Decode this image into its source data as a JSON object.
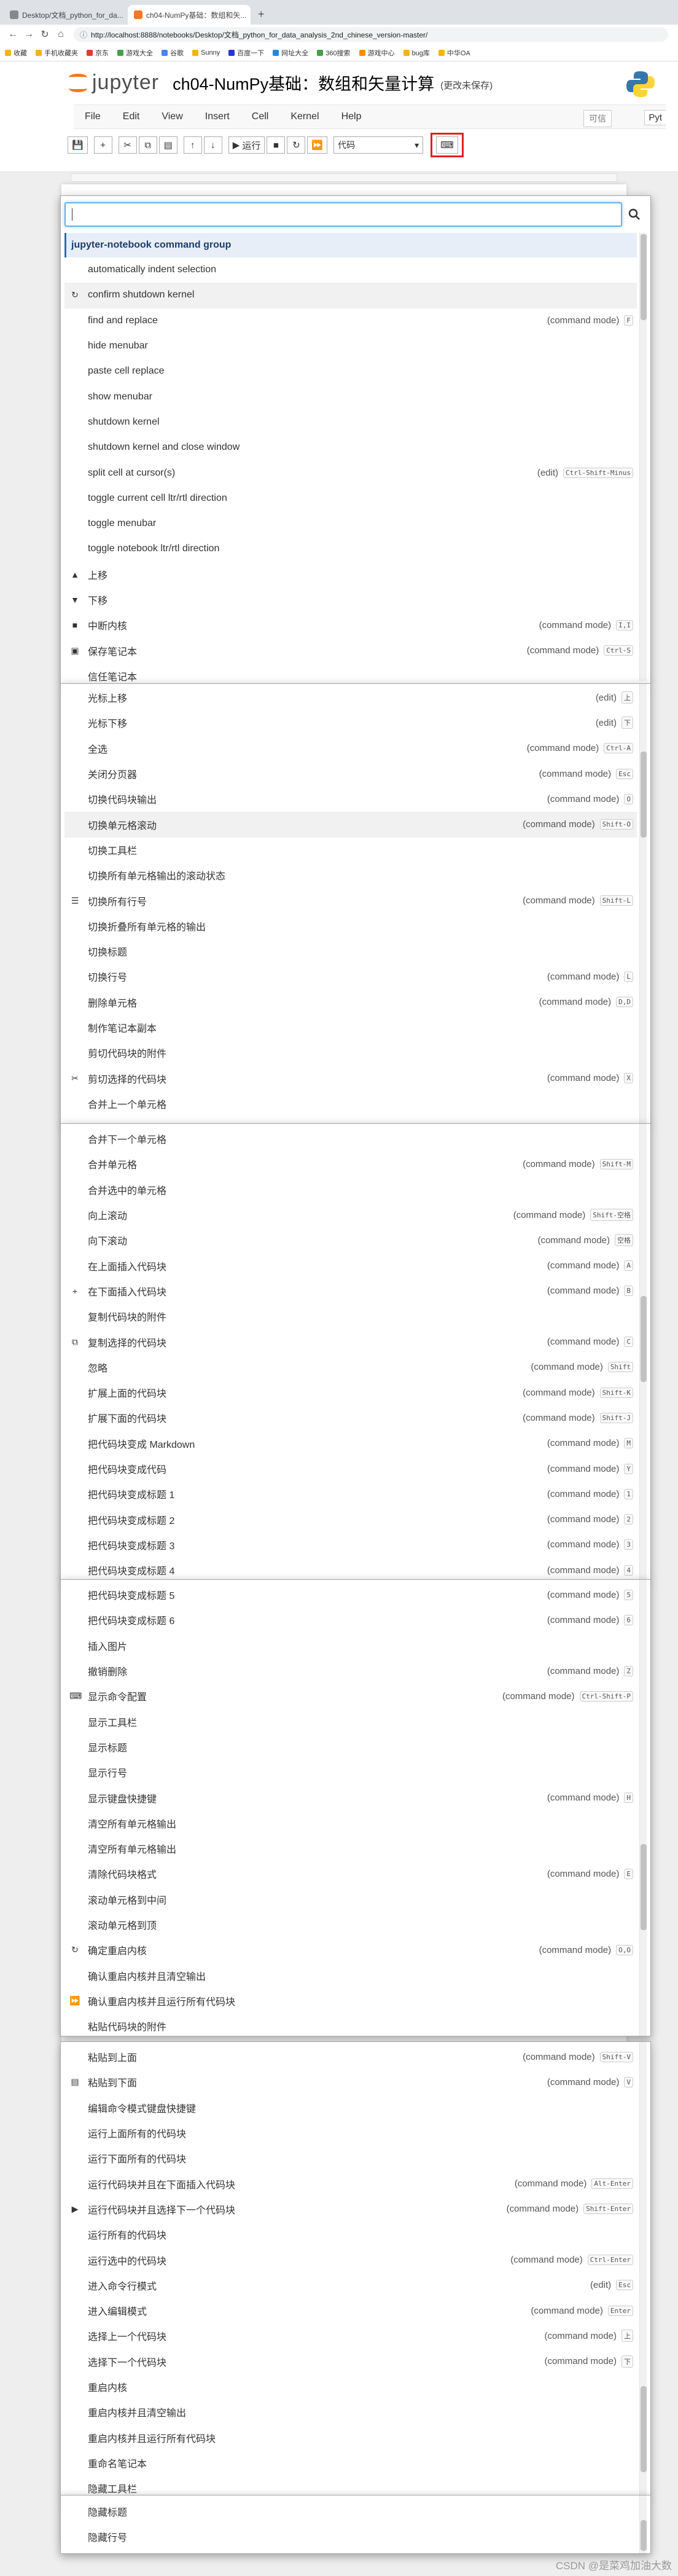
{
  "browser": {
    "tabs": [
      {
        "label": "Desktop/文档_python_for_da..."
      },
      {
        "label": "ch04-NumPy基础：数组和矢..."
      }
    ],
    "url": "http://localhost:8888/notebooks/Desktop/文档_python_for_data_analysis_2nd_chinese_version-master/",
    "bookmarks": [
      "收藏",
      "手机收藏夹",
      "京东",
      "游戏大全",
      "谷歌",
      "Sunny",
      "百度一下",
      "网址大全",
      "360搜索",
      "游戏中心",
      "bug库",
      "中华OA"
    ]
  },
  "jupyter": {
    "wordmark": "jupyter",
    "notebook_title": "ch04-NumPy基础：数组和矢量计算",
    "save_status": "(更改未保存)",
    "trusted": "可信",
    "kernel": "Pyt",
    "menus": [
      "File",
      "Edit",
      "View",
      "Insert",
      "Cell",
      "Kernel",
      "Help"
    ],
    "run_label": "运行",
    "cell_type": "代码"
  },
  "palette": {
    "group_header": "jupyter-notebook command group",
    "panel1": [
      {
        "label": "automatically indent selection",
        "icon": "",
        "mode": "",
        "key": ""
      },
      {
        "label": "confirm shutdown kernel",
        "icon": "↻",
        "mode": "",
        "key": "",
        "hl": true
      },
      {
        "label": "find and replace",
        "icon": "",
        "mode": "(command mode)",
        "key": "F"
      },
      {
        "label": "hide menubar",
        "icon": "",
        "mode": "",
        "key": ""
      },
      {
        "label": "paste cell replace",
        "icon": "",
        "mode": "",
        "key": ""
      },
      {
        "label": "show menubar",
        "icon": "",
        "mode": "",
        "key": ""
      },
      {
        "label": "shutdown kernel",
        "icon": "",
        "mode": "",
        "key": ""
      },
      {
        "label": "shutdown kernel and close window",
        "icon": "",
        "mode": "",
        "key": ""
      },
      {
        "label": "split cell at cursor(s)",
        "icon": "",
        "mode": "(edit)",
        "key": "Ctrl-Shift-Minus"
      },
      {
        "label": "toggle current cell ltr/rtl direction",
        "icon": "",
        "mode": "",
        "key": ""
      },
      {
        "label": "toggle menubar",
        "icon": "",
        "mode": "",
        "key": ""
      },
      {
        "label": "toggle notebook ltr/rtl direction",
        "icon": "",
        "mode": "",
        "key": ""
      },
      {
        "label": "上移",
        "icon": "▲",
        "mode": "",
        "key": ""
      },
      {
        "label": "下移",
        "icon": "▼",
        "mode": "",
        "key": ""
      },
      {
        "label": "中断内核",
        "icon": "■",
        "mode": "(command mode)",
        "key": "I,I"
      },
      {
        "label": "保存笔记本",
        "icon": "▣",
        "mode": "(command mode)",
        "key": "Ctrl-S"
      },
      {
        "label": "信任笔记本",
        "icon": "",
        "mode": "",
        "key": ""
      }
    ],
    "panel2": [
      {
        "label": "光标上移",
        "icon": "",
        "mode": "(edit)",
        "key": "上"
      },
      {
        "label": "光标下移",
        "icon": "",
        "mode": "(edit)",
        "key": "下"
      },
      {
        "label": "全选",
        "icon": "",
        "mode": "(command mode)",
        "key": "Ctrl-A"
      },
      {
        "label": "关闭分页器",
        "icon": "",
        "mode": "(command mode)",
        "key": "Esc"
      },
      {
        "label": "切换代码块输出",
        "icon": "",
        "mode": "(command mode)",
        "key": "O"
      },
      {
        "label": "切换单元格滚动",
        "icon": "",
        "mode": "(command mode)",
        "key": "Shift-O",
        "hl": true
      },
      {
        "label": "切换工具栏",
        "icon": "",
        "mode": "",
        "key": ""
      },
      {
        "label": "切换所有单元格输出的滚动状态",
        "icon": "",
        "mode": "",
        "key": ""
      },
      {
        "label": "切换所有行号",
        "icon": "☰",
        "mode": "(command mode)",
        "key": "Shift-L"
      },
      {
        "label": "切换折叠所有单元格的输出",
        "icon": "",
        "mode": "",
        "key": ""
      },
      {
        "label": "切换标题",
        "icon": "",
        "mode": "",
        "key": ""
      },
      {
        "label": "切换行号",
        "icon": "",
        "mode": "(command mode)",
        "key": "L"
      },
      {
        "label": "删除单元格",
        "icon": "",
        "mode": "(command mode)",
        "key": "D,D"
      },
      {
        "label": "制作笔记本副本",
        "icon": "",
        "mode": "",
        "key": ""
      },
      {
        "label": "剪切代码块的附件",
        "icon": "",
        "mode": "",
        "key": ""
      },
      {
        "label": "剪切选择的代码块",
        "icon": "✂",
        "mode": "(command mode)",
        "key": "X"
      },
      {
        "label": "合并上一个单元格",
        "icon": "",
        "mode": "",
        "key": ""
      }
    ],
    "panel3": [
      {
        "label": "合并下一个单元格",
        "icon": "",
        "mode": "",
        "key": ""
      },
      {
        "label": "合并单元格",
        "icon": "",
        "mode": "(command mode)",
        "key": "Shift-M"
      },
      {
        "label": "合并选中的单元格",
        "icon": "",
        "mode": "",
        "key": ""
      },
      {
        "label": "向上滚动",
        "icon": "",
        "mode": "(command mode)",
        "key": "Shift-空格"
      },
      {
        "label": "向下滚动",
        "icon": "",
        "mode": "(command mode)",
        "key": "空格"
      },
      {
        "label": "在上面插入代码块",
        "icon": "",
        "mode": "(command mode)",
        "key": "A"
      },
      {
        "label": "在下面插入代码块",
        "icon": "+",
        "mode": "(command mode)",
        "key": "B"
      },
      {
        "label": "复制代码块的附件",
        "icon": "",
        "mode": "",
        "key": ""
      },
      {
        "label": "复制选择的代码块",
        "icon": "⧉",
        "mode": "(command mode)",
        "key": "C"
      },
      {
        "label": "忽略",
        "icon": "",
        "mode": "(command mode)",
        "key": "Shift"
      },
      {
        "label": "扩展上面的代码块",
        "icon": "",
        "mode": "(command mode)",
        "key": "Shift-K"
      },
      {
        "label": "扩展下面的代码块",
        "icon": "",
        "mode": "(command mode)",
        "key": "Shift-J"
      },
      {
        "label": "把代码块变成 Markdown",
        "icon": "",
        "mode": "(command mode)",
        "key": "M"
      },
      {
        "label": "把代码块变成代码",
        "icon": "",
        "mode": "(command mode)",
        "key": "Y"
      },
      {
        "label": "把代码块变成标题 1",
        "icon": "",
        "mode": "(command mode)",
        "key": "1"
      },
      {
        "label": "把代码块变成标题 2",
        "icon": "",
        "mode": "(command mode)",
        "key": "2"
      },
      {
        "label": "把代码块变成标题 3",
        "icon": "",
        "mode": "(command mode)",
        "key": "3"
      },
      {
        "label": "把代码块变成标题 4",
        "icon": "",
        "mode": "(command mode)",
        "key": "4"
      }
    ],
    "panel4": [
      {
        "label": "把代码块变成标题 5",
        "icon": "",
        "mode": "(command mode)",
        "key": "5"
      },
      {
        "label": "把代码块变成标题 6",
        "icon": "",
        "mode": "(command mode)",
        "key": "6"
      },
      {
        "label": "插入图片",
        "icon": "",
        "mode": "",
        "key": ""
      },
      {
        "label": "撤销删除",
        "icon": "",
        "mode": "(command mode)",
        "key": "Z"
      },
      {
        "label": "显示命令配置",
        "icon": "⌨",
        "mode": "(command mode)",
        "key": "Ctrl-Shift-P"
      },
      {
        "label": "显示工具栏",
        "icon": "",
        "mode": "",
        "key": ""
      },
      {
        "label": "显示标题",
        "icon": "",
        "mode": "",
        "key": ""
      },
      {
        "label": "显示行号",
        "icon": "",
        "mode": "",
        "key": ""
      },
      {
        "label": "显示键盘快捷键",
        "icon": "",
        "mode": "(command mode)",
        "key": "H"
      },
      {
        "label": "清空所有单元格输出",
        "icon": "",
        "mode": "",
        "key": ""
      },
      {
        "label": "清空所有单元格输出",
        "icon": "",
        "mode": "",
        "key": ""
      },
      {
        "label": "清除代码块格式",
        "icon": "",
        "mode": "(command mode)",
        "key": "E"
      },
      {
        "label": "滚动单元格到中间",
        "icon": "",
        "mode": "",
        "key": ""
      },
      {
        "label": "滚动单元格到顶",
        "icon": "",
        "mode": "",
        "key": ""
      },
      {
        "label": "确定重启内核",
        "icon": "↻",
        "mode": "(command mode)",
        "key": "O,O"
      },
      {
        "label": "确认重启内核并且清空输出",
        "icon": "",
        "mode": "",
        "key": ""
      },
      {
        "label": "确认重启内核并且运行所有代码块",
        "icon": "⏩",
        "mode": "",
        "key": ""
      },
      {
        "label": "粘贴代码块的附件",
        "icon": "",
        "mode": "",
        "key": ""
      }
    ],
    "panel5": [
      {
        "label": "粘贴到上面",
        "icon": "",
        "mode": "(command mode)",
        "key": "Shift-V"
      },
      {
        "label": "粘贴到下面",
        "icon": "▤",
        "mode": "(command mode)",
        "key": "V"
      },
      {
        "label": "编辑命令模式键盘快捷键",
        "icon": "",
        "mode": "",
        "key": ""
      },
      {
        "label": "运行上面所有的代码块",
        "icon": "",
        "mode": "",
        "key": ""
      },
      {
        "label": "运行下面所有的代码块",
        "icon": "",
        "mode": "",
        "key": ""
      },
      {
        "label": "运行代码块并且在下面插入代码块",
        "icon": "",
        "mode": "(command mode)",
        "key": "Alt-Enter"
      },
      {
        "label": "运行代码块并且选择下一个代码块",
        "icon": "▶",
        "mode": "(command mode)",
        "key": "Shift-Enter"
      },
      {
        "label": "运行所有的代码块",
        "icon": "",
        "mode": "",
        "key": ""
      },
      {
        "label": "运行选中的代码块",
        "icon": "",
        "mode": "(command mode)",
        "key": "Ctrl-Enter"
      },
      {
        "label": "进入命令行模式",
        "icon": "",
        "mode": "(edit)",
        "key": "Esc"
      },
      {
        "label": "进入编辑模式",
        "icon": "",
        "mode": "(command mode)",
        "key": "Enter"
      },
      {
        "label": "选择上一个代码块",
        "icon": "",
        "mode": "(command mode)",
        "key": "上"
      },
      {
        "label": "选择下一个代码块",
        "icon": "",
        "mode": "(command mode)",
        "key": "下"
      },
      {
        "label": "重启内核",
        "icon": "",
        "mode": "",
        "key": ""
      },
      {
        "label": "重启内核并且清空输出",
        "icon": "",
        "mode": "",
        "key": ""
      },
      {
        "label": "重启内核并且运行所有代码块",
        "icon": "",
        "mode": "",
        "key": ""
      },
      {
        "label": "重命名笔记本",
        "icon": "",
        "mode": "",
        "key": ""
      },
      {
        "label": "隐藏工具栏",
        "icon": "",
        "mode": "",
        "key": ""
      }
    ],
    "panel6": [
      {
        "label": "隐藏标题",
        "icon": "",
        "mode": "",
        "key": ""
      },
      {
        "label": "隐藏行号",
        "icon": "",
        "mode": "",
        "key": ""
      }
    ]
  },
  "watermark": "CSDN @是菜鸡加油大数"
}
